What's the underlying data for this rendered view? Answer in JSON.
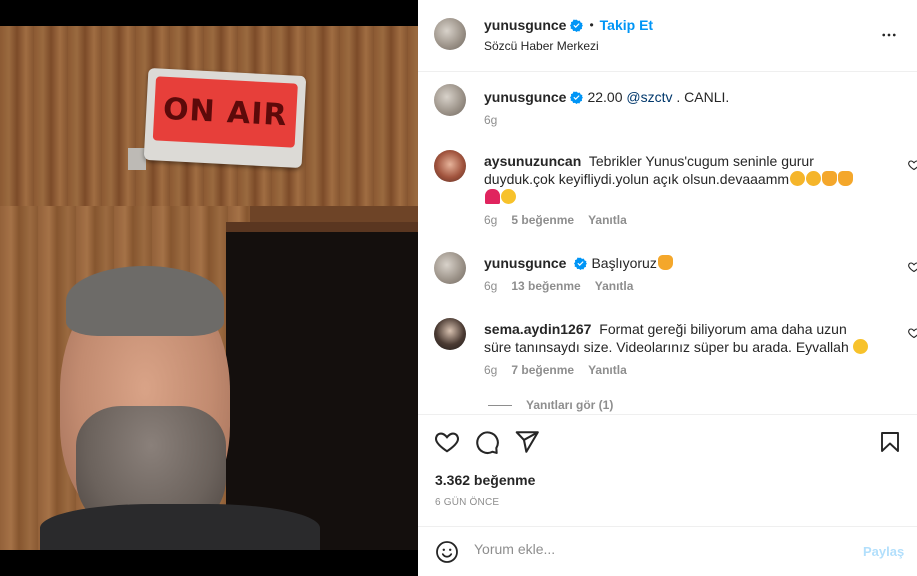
{
  "post": {
    "image_alt": "ON AIR",
    "sign_text": "ON AIR"
  },
  "header": {
    "username": "yunusgunce",
    "separator": "•",
    "follow_label": "Takip Et",
    "subtitle": "Sözcü Haber Merkezi",
    "more_icon": "more-horizontal-icon"
  },
  "caption": {
    "username": "yunusgunce",
    "text_before": "22.00 ",
    "mention": "@szctv",
    "text_after": " . CANLI.",
    "time": "6g"
  },
  "comments": [
    {
      "username": "aysunuzuncan",
      "text": "Tebrikler Yunus'cugum seninle gurur duyduk.çok keyifliydi.yolun açık olsun.devaaamm",
      "time": "6g",
      "likes": "5 beğenme",
      "reply": "Yanıtla"
    },
    {
      "username": "yunusgunce",
      "text": "Başlıyoruz",
      "time": "6g",
      "likes": "13 beğenme",
      "reply": "Yanıtla"
    },
    {
      "username": "sema.aydin1267",
      "text": "Format gereği biliyorum ama daha uzun süre tanınsaydı size. Videolarınız süper bu arada. Eyvallah",
      "time": "6g",
      "likes": "7 beğenme",
      "reply": "Yanıtla"
    }
  ],
  "view_replies": "Yanıtları gör (1)",
  "engagement": {
    "likes": "3.362 beğenme",
    "date": "6 GÜN ÖNCE"
  },
  "compose": {
    "placeholder": "Yorum ekle...",
    "share_label": "Paylaş"
  },
  "colors": {
    "accent": "#0095f6",
    "verified": "#0095f6",
    "muted": "#8e8e8e"
  }
}
